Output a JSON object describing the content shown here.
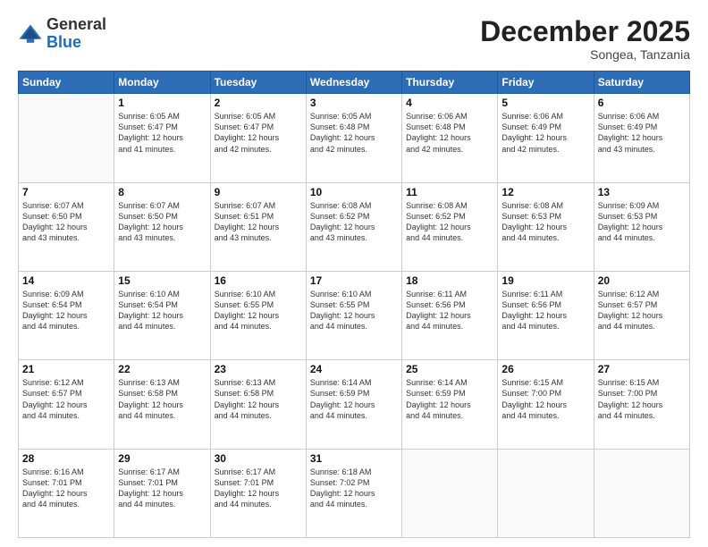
{
  "logo": {
    "general": "General",
    "blue": "Blue"
  },
  "title": "December 2025",
  "location": "Songea, Tanzania",
  "weekdays": [
    "Sunday",
    "Monday",
    "Tuesday",
    "Wednesday",
    "Thursday",
    "Friday",
    "Saturday"
  ],
  "weeks": [
    [
      {
        "day": "",
        "info": ""
      },
      {
        "day": "1",
        "info": "Sunrise: 6:05 AM\nSunset: 6:47 PM\nDaylight: 12 hours\nand 41 minutes."
      },
      {
        "day": "2",
        "info": "Sunrise: 6:05 AM\nSunset: 6:47 PM\nDaylight: 12 hours\nand 42 minutes."
      },
      {
        "day": "3",
        "info": "Sunrise: 6:05 AM\nSunset: 6:48 PM\nDaylight: 12 hours\nand 42 minutes."
      },
      {
        "day": "4",
        "info": "Sunrise: 6:06 AM\nSunset: 6:48 PM\nDaylight: 12 hours\nand 42 minutes."
      },
      {
        "day": "5",
        "info": "Sunrise: 6:06 AM\nSunset: 6:49 PM\nDaylight: 12 hours\nand 42 minutes."
      },
      {
        "day": "6",
        "info": "Sunrise: 6:06 AM\nSunset: 6:49 PM\nDaylight: 12 hours\nand 43 minutes."
      }
    ],
    [
      {
        "day": "7",
        "info": "Sunrise: 6:07 AM\nSunset: 6:50 PM\nDaylight: 12 hours\nand 43 minutes."
      },
      {
        "day": "8",
        "info": "Sunrise: 6:07 AM\nSunset: 6:50 PM\nDaylight: 12 hours\nand 43 minutes."
      },
      {
        "day": "9",
        "info": "Sunrise: 6:07 AM\nSunset: 6:51 PM\nDaylight: 12 hours\nand 43 minutes."
      },
      {
        "day": "10",
        "info": "Sunrise: 6:08 AM\nSunset: 6:52 PM\nDaylight: 12 hours\nand 43 minutes."
      },
      {
        "day": "11",
        "info": "Sunrise: 6:08 AM\nSunset: 6:52 PM\nDaylight: 12 hours\nand 44 minutes."
      },
      {
        "day": "12",
        "info": "Sunrise: 6:08 AM\nSunset: 6:53 PM\nDaylight: 12 hours\nand 44 minutes."
      },
      {
        "day": "13",
        "info": "Sunrise: 6:09 AM\nSunset: 6:53 PM\nDaylight: 12 hours\nand 44 minutes."
      }
    ],
    [
      {
        "day": "14",
        "info": "Sunrise: 6:09 AM\nSunset: 6:54 PM\nDaylight: 12 hours\nand 44 minutes."
      },
      {
        "day": "15",
        "info": "Sunrise: 6:10 AM\nSunset: 6:54 PM\nDaylight: 12 hours\nand 44 minutes."
      },
      {
        "day": "16",
        "info": "Sunrise: 6:10 AM\nSunset: 6:55 PM\nDaylight: 12 hours\nand 44 minutes."
      },
      {
        "day": "17",
        "info": "Sunrise: 6:10 AM\nSunset: 6:55 PM\nDaylight: 12 hours\nand 44 minutes."
      },
      {
        "day": "18",
        "info": "Sunrise: 6:11 AM\nSunset: 6:56 PM\nDaylight: 12 hours\nand 44 minutes."
      },
      {
        "day": "19",
        "info": "Sunrise: 6:11 AM\nSunset: 6:56 PM\nDaylight: 12 hours\nand 44 minutes."
      },
      {
        "day": "20",
        "info": "Sunrise: 6:12 AM\nSunset: 6:57 PM\nDaylight: 12 hours\nand 44 minutes."
      }
    ],
    [
      {
        "day": "21",
        "info": "Sunrise: 6:12 AM\nSunset: 6:57 PM\nDaylight: 12 hours\nand 44 minutes."
      },
      {
        "day": "22",
        "info": "Sunrise: 6:13 AM\nSunset: 6:58 PM\nDaylight: 12 hours\nand 44 minutes."
      },
      {
        "day": "23",
        "info": "Sunrise: 6:13 AM\nSunset: 6:58 PM\nDaylight: 12 hours\nand 44 minutes."
      },
      {
        "day": "24",
        "info": "Sunrise: 6:14 AM\nSunset: 6:59 PM\nDaylight: 12 hours\nand 44 minutes."
      },
      {
        "day": "25",
        "info": "Sunrise: 6:14 AM\nSunset: 6:59 PM\nDaylight: 12 hours\nand 44 minutes."
      },
      {
        "day": "26",
        "info": "Sunrise: 6:15 AM\nSunset: 7:00 PM\nDaylight: 12 hours\nand 44 minutes."
      },
      {
        "day": "27",
        "info": "Sunrise: 6:15 AM\nSunset: 7:00 PM\nDaylight: 12 hours\nand 44 minutes."
      }
    ],
    [
      {
        "day": "28",
        "info": "Sunrise: 6:16 AM\nSunset: 7:01 PM\nDaylight: 12 hours\nand 44 minutes."
      },
      {
        "day": "29",
        "info": "Sunrise: 6:17 AM\nSunset: 7:01 PM\nDaylight: 12 hours\nand 44 minutes."
      },
      {
        "day": "30",
        "info": "Sunrise: 6:17 AM\nSunset: 7:01 PM\nDaylight: 12 hours\nand 44 minutes."
      },
      {
        "day": "31",
        "info": "Sunrise: 6:18 AM\nSunset: 7:02 PM\nDaylight: 12 hours\nand 44 minutes."
      },
      {
        "day": "",
        "info": ""
      },
      {
        "day": "",
        "info": ""
      },
      {
        "day": "",
        "info": ""
      }
    ]
  ]
}
